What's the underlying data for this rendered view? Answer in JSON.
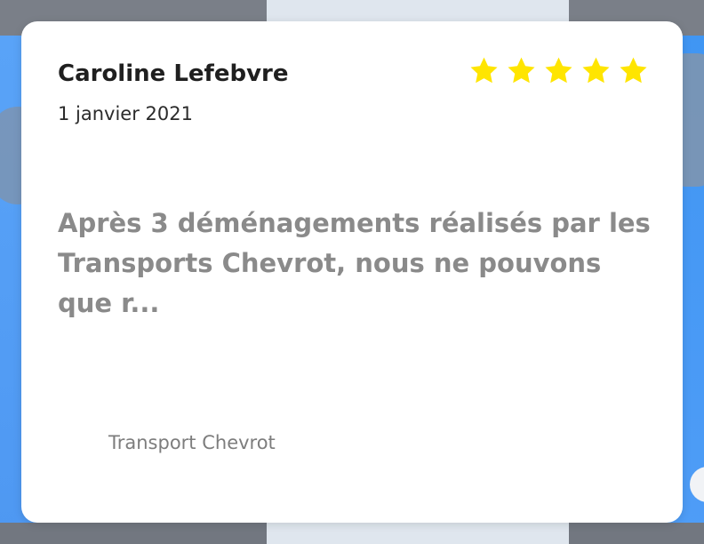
{
  "review": {
    "author": "Caroline Lefebvre",
    "date": "1 janvier 2021",
    "rating": 5,
    "rating_max": 5,
    "excerpt": "Après 3 déménagements réalisés par les Transports Chevrot, nous ne pouvons que r...",
    "source": "Transport Chevrot"
  },
  "colors": {
    "star": "#ffe500",
    "card_background": "#ffffff",
    "page_background": "#4f9df7"
  },
  "icons": {
    "star": "star-icon"
  }
}
